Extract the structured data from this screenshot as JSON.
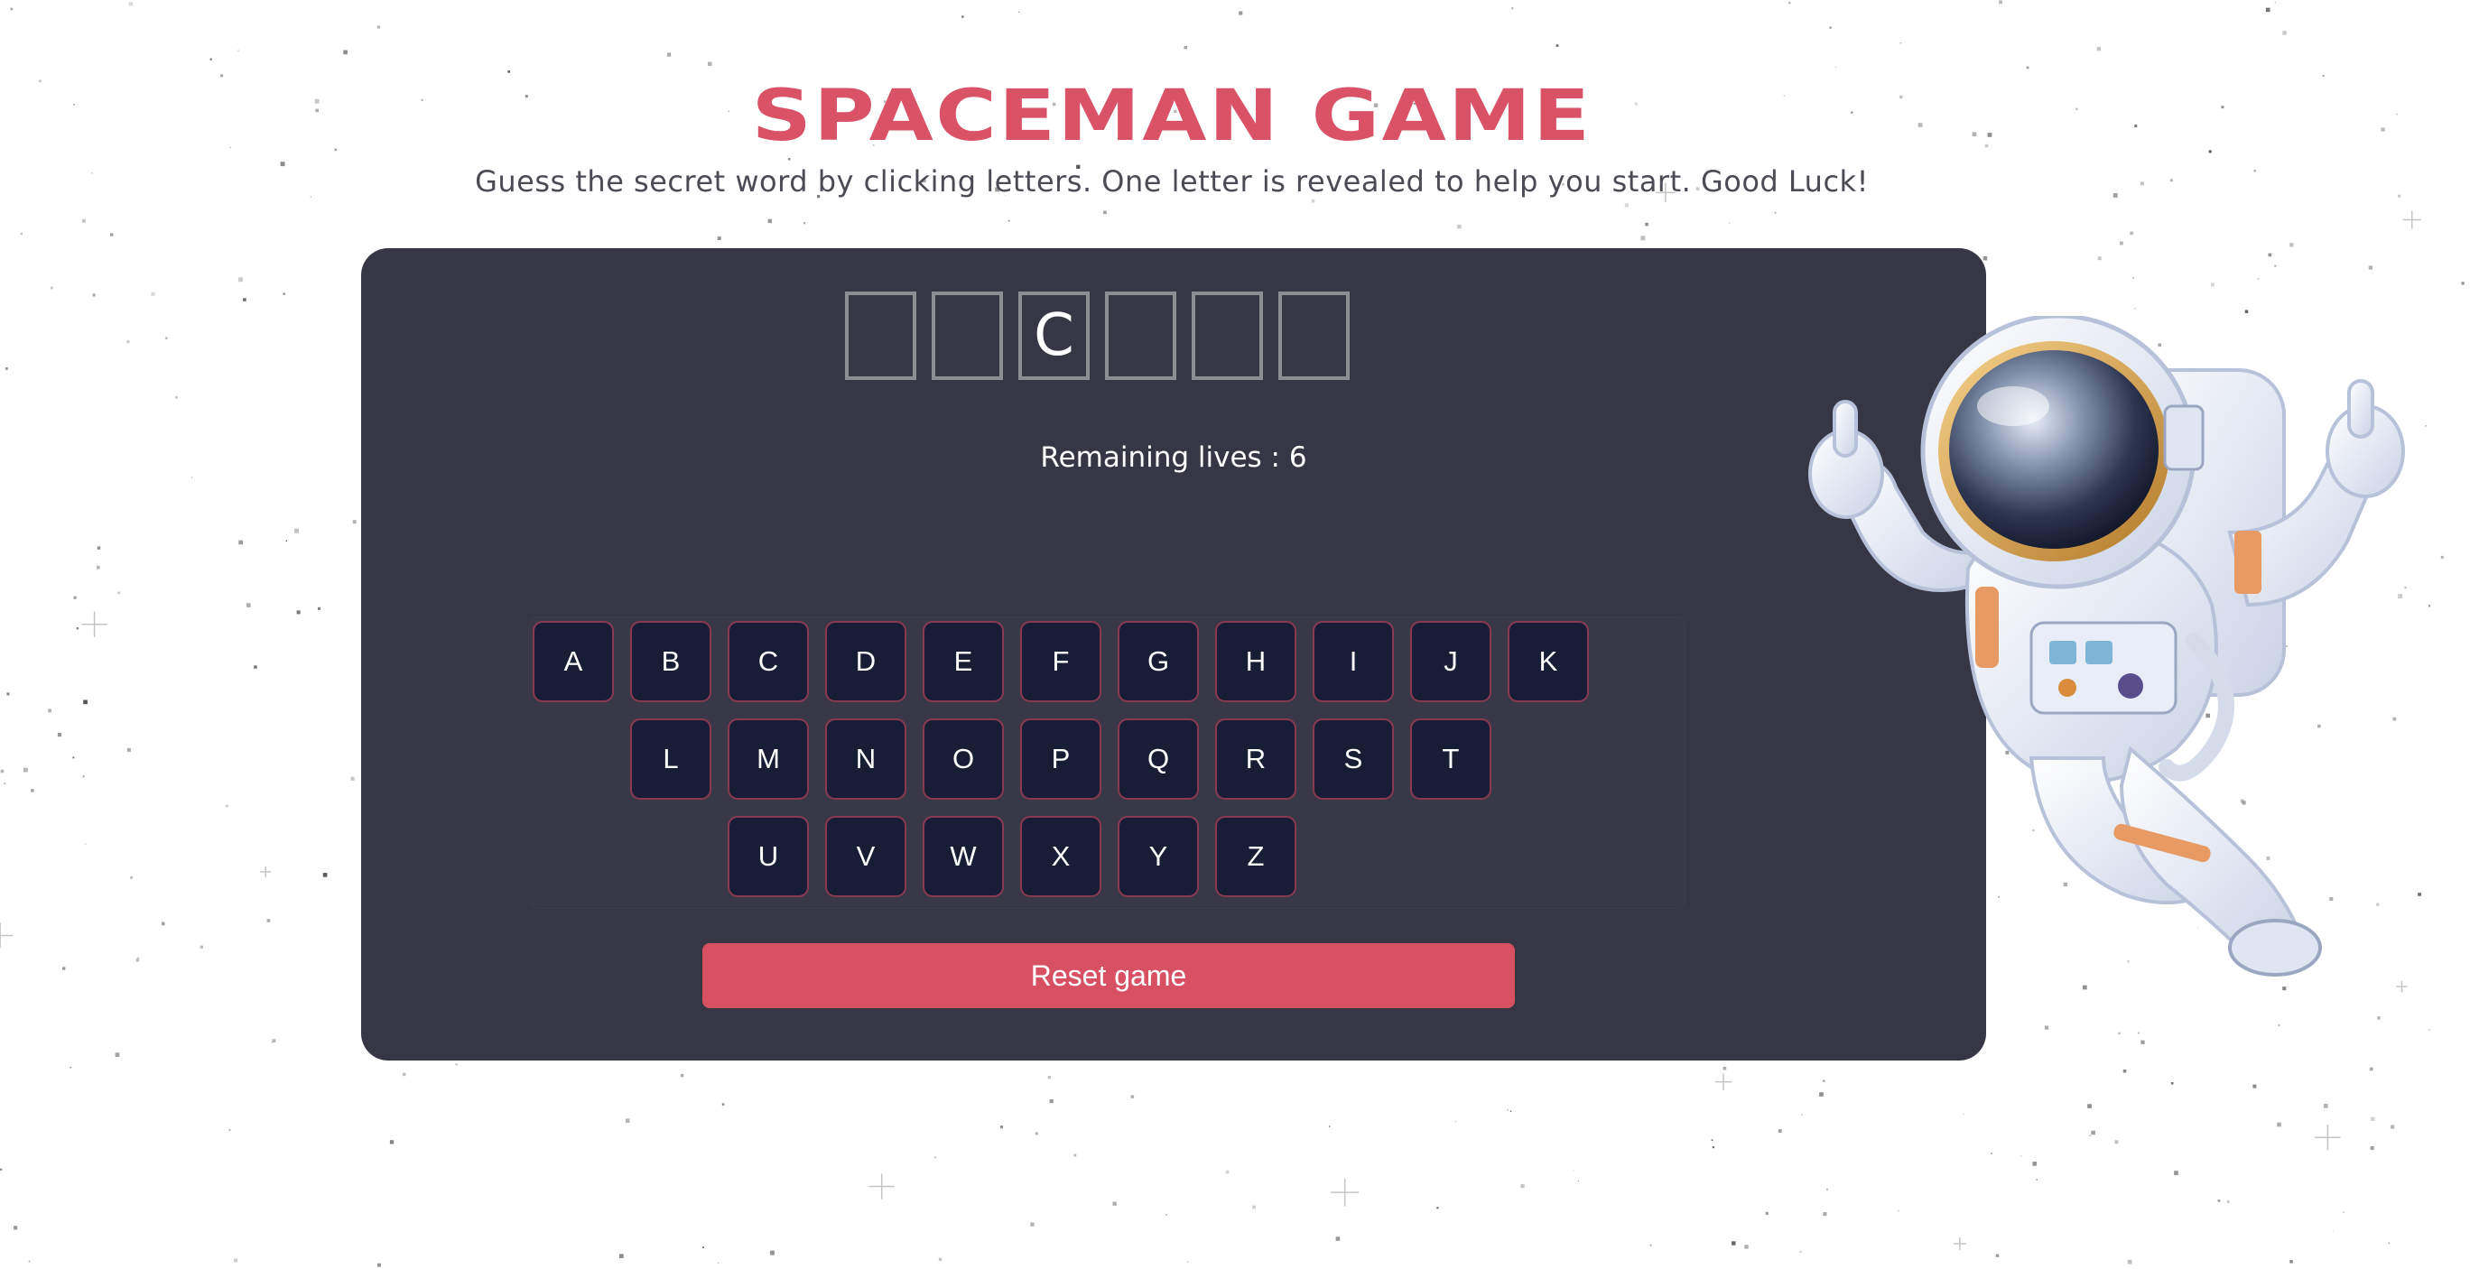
{
  "header": {
    "title": "SPACEMAN GAME",
    "subtitle": "Guess the secret word by clicking letters. One letter is revealed to help you start. Good Luck!"
  },
  "word": {
    "slots": [
      "",
      "",
      "C",
      "",
      "",
      ""
    ]
  },
  "status": {
    "lives_text": "Remaining lives : 6"
  },
  "keyboard": {
    "rows": [
      [
        "A",
        "B",
        "C",
        "D",
        "E",
        "F",
        "G",
        "H",
        "I",
        "J",
        "K"
      ],
      [
        "L",
        "M",
        "N",
        "O",
        "P",
        "Q",
        "R",
        "S",
        "T"
      ],
      [
        "U",
        "V",
        "W",
        "X",
        "Y",
        "Z"
      ]
    ]
  },
  "controls": {
    "reset_label": "Reset game"
  },
  "colors": {
    "accent": "#d85163",
    "panel": "#363645",
    "key_bg": "#181d36",
    "key_border": "#8a3a4f",
    "slot_border": "#8d8d94"
  },
  "icons": {
    "astronaut": "astronaut-illustration"
  }
}
